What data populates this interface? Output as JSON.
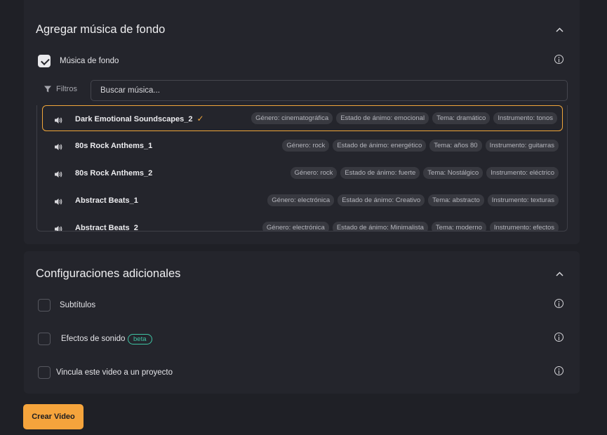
{
  "music_section": {
    "title": "Agregar música de fondo",
    "background_music_label": "Música de fondo",
    "filters_label": "Filtros",
    "search_placeholder": "Buscar música...",
    "tracks": [
      {
        "name": "Dark Emotional Soundscapes_2",
        "selected": true,
        "tags": [
          "Género: cinematográfica",
          "Estado de ánimo: emocional",
          "Tema: dramático",
          "Instrumento: tonos"
        ]
      },
      {
        "name": "80s Rock Anthems_1",
        "tags": [
          "Género: rock",
          "Estado de ánimo: energético",
          "Tema: años 80",
          "Instrumento: guitarras"
        ]
      },
      {
        "name": "80s Rock Anthems_2",
        "tags": [
          "Género: rock",
          "Estado de ánimo: fuerte",
          "Tema: Nostálgico",
          "Instrumento: eléctrico"
        ]
      },
      {
        "name": "Abstract Beats_1",
        "tags": [
          "Género: electrónica",
          "Estado de ánimo: Creativo",
          "Tema: abstracto",
          "Instrumento: texturas"
        ]
      },
      {
        "name": "Abstract Beats_2",
        "tags": [
          "Género: electrónica",
          "Estado de ánimo: Minimalista",
          "Tema: moderno",
          "Instrumento: efectos"
        ]
      }
    ]
  },
  "extra_section": {
    "title": "Configuraciones adicionales",
    "options": [
      {
        "label": "Subtítulos"
      },
      {
        "label": "Efectos de sonido",
        "badge": "beta"
      },
      {
        "label": "Vincula este video a un proyecto"
      }
    ]
  },
  "create_button_label": "Crear Video",
  "colors": {
    "accent": "#f5a43c",
    "badge": "#3fc4a4",
    "panel": "#24252c",
    "background": "#1f2026"
  }
}
